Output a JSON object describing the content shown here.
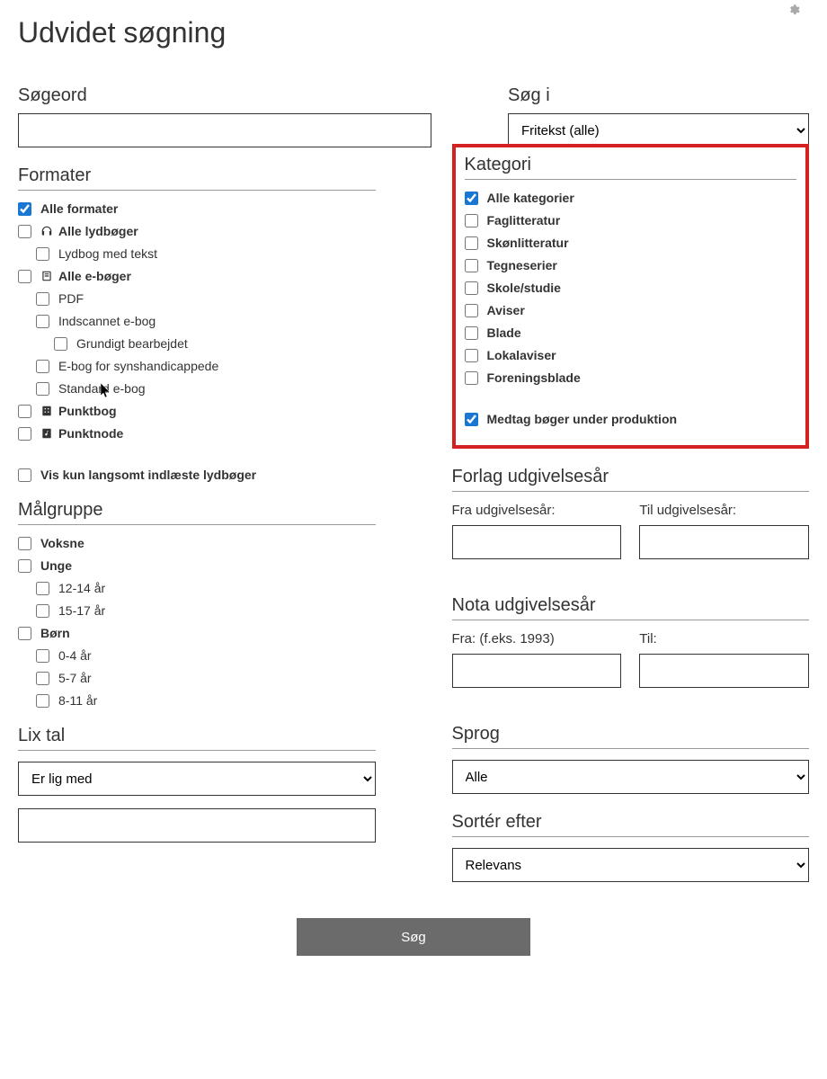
{
  "page_title": "Udvidet søgning",
  "search_word": {
    "label": "Søgeord",
    "value": ""
  },
  "search_in": {
    "label": "Søg i",
    "selected": "Fritekst (alle)"
  },
  "formater": {
    "heading": "Formater",
    "items": [
      {
        "label": "Alle formater",
        "checked": true,
        "bold": true,
        "indent": 0
      },
      {
        "label": "Alle lydbøger",
        "checked": false,
        "bold": true,
        "indent": 0,
        "icon": "headphones"
      },
      {
        "label": "Lydbog med tekst",
        "checked": false,
        "bold": false,
        "indent": 1
      },
      {
        "label": "Alle e-bøger",
        "checked": false,
        "bold": true,
        "indent": 0,
        "icon": "book"
      },
      {
        "label": "PDF",
        "checked": false,
        "bold": false,
        "indent": 1
      },
      {
        "label": "Indscannet e-bog",
        "checked": false,
        "bold": false,
        "indent": 1
      },
      {
        "label": "Grundigt bearbejdet",
        "checked": false,
        "bold": false,
        "indent": 2
      },
      {
        "label": "E-bog for synshandicappede",
        "checked": false,
        "bold": false,
        "indent": 1
      },
      {
        "label": "Standard e-bog",
        "checked": false,
        "bold": false,
        "indent": 1
      },
      {
        "label": "Punktbog",
        "checked": false,
        "bold": true,
        "indent": 0,
        "icon": "braille"
      },
      {
        "label": "Punktnode",
        "checked": false,
        "bold": true,
        "indent": 0,
        "icon": "note"
      }
    ],
    "vis_kun": "Vis kun langsomt indlæste lydbøger"
  },
  "maalgruppe": {
    "heading": "Målgruppe",
    "items": [
      {
        "label": "Voksne",
        "checked": false,
        "bold": true,
        "indent": 0
      },
      {
        "label": "Unge",
        "checked": false,
        "bold": true,
        "indent": 0
      },
      {
        "label": "12-14 år",
        "checked": false,
        "bold": false,
        "indent": 1
      },
      {
        "label": "15-17 år",
        "checked": false,
        "bold": false,
        "indent": 1
      },
      {
        "label": "Børn",
        "checked": false,
        "bold": true,
        "indent": 0
      },
      {
        "label": "0-4 år",
        "checked": false,
        "bold": false,
        "indent": 1
      },
      {
        "label": "5-7 år",
        "checked": false,
        "bold": false,
        "indent": 1
      },
      {
        "label": "8-11 år",
        "checked": false,
        "bold": false,
        "indent": 1
      }
    ]
  },
  "lix": {
    "heading": "Lix tal",
    "selected": "Er lig med",
    "value": ""
  },
  "kategori": {
    "heading": "Kategori",
    "items": [
      {
        "label": "Alle kategorier",
        "checked": true
      },
      {
        "label": "Faglitteratur",
        "checked": false
      },
      {
        "label": "Skønlitteratur",
        "checked": false
      },
      {
        "label": "Tegneserier",
        "checked": false
      },
      {
        "label": "Skole/studie",
        "checked": false
      },
      {
        "label": "Aviser",
        "checked": false
      },
      {
        "label": "Blade",
        "checked": false
      },
      {
        "label": "Lokalaviser",
        "checked": false
      },
      {
        "label": "Foreningsblade",
        "checked": false
      }
    ],
    "medtag": {
      "label": "Medtag bøger under produktion",
      "checked": true
    }
  },
  "forlag_aar": {
    "heading": "Forlag udgivelsesår",
    "fra_label": "Fra udgivelsesår:",
    "til_label": "Til udgivelsesår:",
    "fra_value": "",
    "til_value": ""
  },
  "nota_aar": {
    "heading": "Nota udgivelsesår",
    "fra_label": "Fra: (f.eks. 1993)",
    "til_label": "Til:",
    "fra_value": "",
    "til_value": ""
  },
  "sprog": {
    "heading": "Sprog",
    "selected": "Alle"
  },
  "sort": {
    "heading": "Sortér efter",
    "selected": "Relevans"
  },
  "submit": "Søg"
}
